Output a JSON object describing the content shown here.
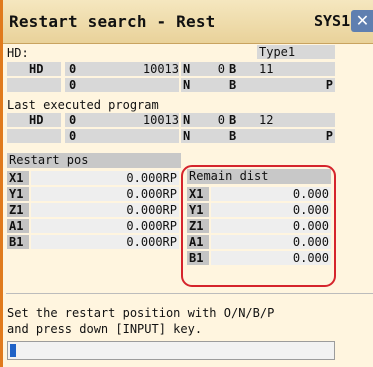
{
  "window": {
    "title": "Restart search - Rest",
    "system": "SYS1",
    "close_glyph": "✕"
  },
  "hd_label": "HD:",
  "type_value": "Type1",
  "hd_rows": [
    {
      "c1": "HD",
      "c2": "0",
      "num": "10013",
      "n_label": "N",
      "n_val": "0",
      "b_label": "B",
      "b_val": "11",
      "p_label": ""
    },
    {
      "c1": "",
      "c2": "0",
      "num": "",
      "n_label": "N",
      "n_val": "",
      "b_label": "B",
      "b_val": "",
      "p_label": "P"
    }
  ],
  "last_program_label": "Last executed program",
  "last_rows": [
    {
      "c1": "HD",
      "c2": "0",
      "num": "10013",
      "n_label": "N",
      "n_val": "0",
      "b_label": "B",
      "b_val": "12",
      "p_label": ""
    },
    {
      "c1": "",
      "c2": "0",
      "num": "",
      "n_label": "N",
      "n_val": "",
      "b_label": "B",
      "b_val": "",
      "p_label": "P"
    }
  ],
  "restart_pos": {
    "header": "Restart pos",
    "rows": [
      {
        "axis": "X1",
        "value": "0.000RP"
      },
      {
        "axis": "Y1",
        "value": "0.000RP"
      },
      {
        "axis": "Z1",
        "value": "0.000RP"
      },
      {
        "axis": "A1",
        "value": "0.000RP"
      },
      {
        "axis": "B1",
        "value": "0.000RP"
      }
    ]
  },
  "remain_dist": {
    "header": "Remain dist",
    "rows": [
      {
        "axis": "X1",
        "value": "0.000"
      },
      {
        "axis": "Y1",
        "value": "0.000"
      },
      {
        "axis": "Z1",
        "value": "0.000"
      },
      {
        "axis": "A1",
        "value": "0.000"
      },
      {
        "axis": "B1",
        "value": "0.000"
      }
    ]
  },
  "message_line1": "Set the restart position with O/N/B/P",
  "message_line2": "and press down [INPUT] key.",
  "input": {
    "value": ""
  },
  "colors": {
    "frame_bg": "#fff5df",
    "accent_border": "#e07a1c",
    "highlight": "#d5242c",
    "close_bg": "#5f7fb0",
    "cursor": "#1f62c7"
  }
}
